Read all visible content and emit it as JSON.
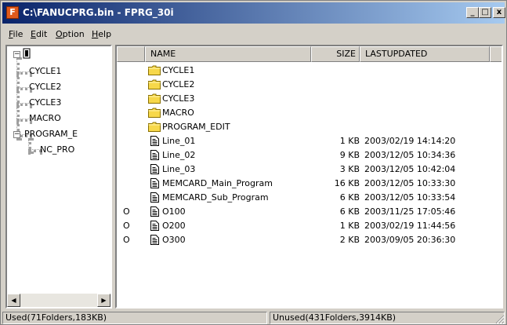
{
  "window": {
    "title": "C:\\FANUCPRG.bin - FPRG_30i",
    "app_icon_letter": "F"
  },
  "caption_buttons": {
    "minimize": "_",
    "maximize": "□",
    "close": "x"
  },
  "menu": [
    {
      "label": "File",
      "underline": "F",
      "rest": "ile"
    },
    {
      "label": "Edit",
      "underline": "E",
      "rest": "dit"
    },
    {
      "label": "Option",
      "underline": "O",
      "rest": "ption"
    },
    {
      "label": "Help",
      "underline": "H",
      "rest": "elp"
    }
  ],
  "tree": {
    "root_icon": "memory-card-icon",
    "items": [
      {
        "label": "CYCLE1"
      },
      {
        "label": "CYCLE2"
      },
      {
        "label": "CYCLE3"
      },
      {
        "label": "MACRO"
      },
      {
        "label": "PROGRAM_E",
        "expanded": true
      },
      {
        "label": "NC_PRO"
      }
    ]
  },
  "list": {
    "columns": {
      "name": "NAME",
      "size": "SIZE",
      "updated": "LASTUPDATED"
    },
    "rows": [
      {
        "mark": "",
        "type": "folder",
        "name": "CYCLE1",
        "size": "",
        "date": ""
      },
      {
        "mark": "",
        "type": "folder",
        "name": "CYCLE2",
        "size": "",
        "date": ""
      },
      {
        "mark": "",
        "type": "folder",
        "name": "CYCLE3",
        "size": "",
        "date": ""
      },
      {
        "mark": "",
        "type": "folder",
        "name": "MACRO",
        "size": "",
        "date": ""
      },
      {
        "mark": "",
        "type": "folder",
        "name": "PROGRAM_EDIT",
        "size": "",
        "date": ""
      },
      {
        "mark": "",
        "type": "file",
        "name": "Line_01",
        "size": "1 KB",
        "date": "2003/02/19 14:14:20"
      },
      {
        "mark": "",
        "type": "file",
        "name": "Line_02",
        "size": "9 KB",
        "date": "2003/12/05 10:34:36"
      },
      {
        "mark": "",
        "type": "file",
        "name": "Line_03",
        "size": "3 KB",
        "date": "2003/12/05 10:42:04"
      },
      {
        "mark": "",
        "type": "file",
        "name": "MEMCARD_Main_Program",
        "size": "16 KB",
        "date": "2003/12/05 10:33:30"
      },
      {
        "mark": "",
        "type": "file",
        "name": "MEMCARD_Sub_Program",
        "size": "6 KB",
        "date": "2003/12/05 10:33:54"
      },
      {
        "mark": "O",
        "type": "file",
        "name": "O100",
        "size": "6 KB",
        "date": "2003/11/25 17:05:46"
      },
      {
        "mark": "O",
        "type": "file",
        "name": "O200",
        "size": "1 KB",
        "date": "2003/02/19 11:44:56"
      },
      {
        "mark": "O",
        "type": "file",
        "name": "O300",
        "size": "2 KB",
        "date": "2003/09/05 20:36:30"
      }
    ]
  },
  "status": {
    "used": "Used(71Folders,183KB)",
    "unused": "Unused(431Folders,3914KB)"
  },
  "colors": {
    "title_start": "#0a246a",
    "title_end": "#a6caf0",
    "folder": "#f7d84a",
    "face": "#d4d0c8"
  }
}
